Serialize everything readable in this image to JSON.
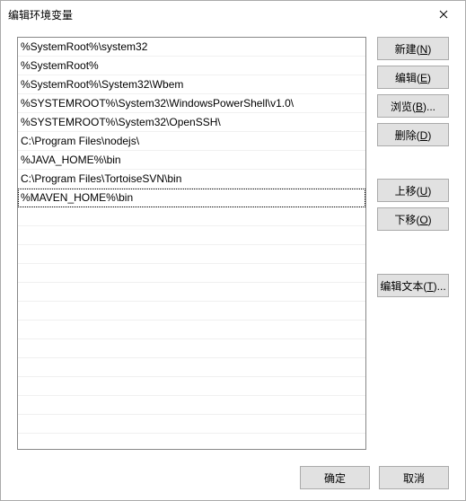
{
  "window": {
    "title": "编辑环境变量"
  },
  "list": {
    "items": [
      "%SystemRoot%\\system32",
      "%SystemRoot%",
      "%SystemRoot%\\System32\\Wbem",
      "%SYSTEMROOT%\\System32\\WindowsPowerShell\\v1.0\\",
      "%SYSTEMROOT%\\System32\\OpenSSH\\",
      "C:\\Program Files\\nodejs\\",
      "%JAVA_HOME%\\bin",
      "C:\\Program Files\\TortoiseSVN\\bin",
      "%MAVEN_HOME%\\bin"
    ],
    "selected_index": 8
  },
  "buttons": {
    "new_": {
      "text": "新建(",
      "mn": "N",
      "tail": ")"
    },
    "edit": {
      "text": "编辑(",
      "mn": "E",
      "tail": ")"
    },
    "browse": {
      "text": "浏览(",
      "mn": "B",
      "tail": ")..."
    },
    "delete": {
      "text": "删除(",
      "mn": "D",
      "tail": ")"
    },
    "up": {
      "text": "上移(",
      "mn": "U",
      "tail": ")"
    },
    "down": {
      "text": "下移(",
      "mn": "O",
      "tail": ")"
    },
    "edittext": {
      "text": "编辑文本(",
      "mn": "T",
      "tail": ")..."
    },
    "ok": "确定",
    "cancel": "取消"
  }
}
